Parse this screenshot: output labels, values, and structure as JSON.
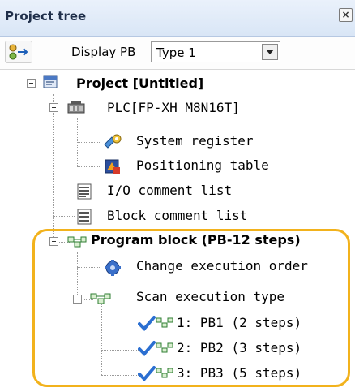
{
  "panel": {
    "title": "Project tree",
    "close_glyph": "×"
  },
  "toolbar": {
    "display_label": "Display PB",
    "type_value": "Type 1"
  },
  "tree": {
    "project": "Project [Untitled]",
    "plc": "PLC[FP-XH M8N16T]",
    "system_register": "System register",
    "positioning_table": "Positioning table",
    "io_comment_list": "I/O comment list",
    "block_comment_list": "Block comment list",
    "program_block": "Program block (PB-12 steps)",
    "change_exec_order": "Change execution order",
    "scan_exec_type": "Scan execution type",
    "pb_items": [
      "1: PB1 (2 steps)",
      "2: PB2 (3 steps)",
      "3: PB3 (5 steps)"
    ]
  },
  "colors": {
    "highlight": "#f2b21c",
    "check": "#2b6fd1"
  }
}
